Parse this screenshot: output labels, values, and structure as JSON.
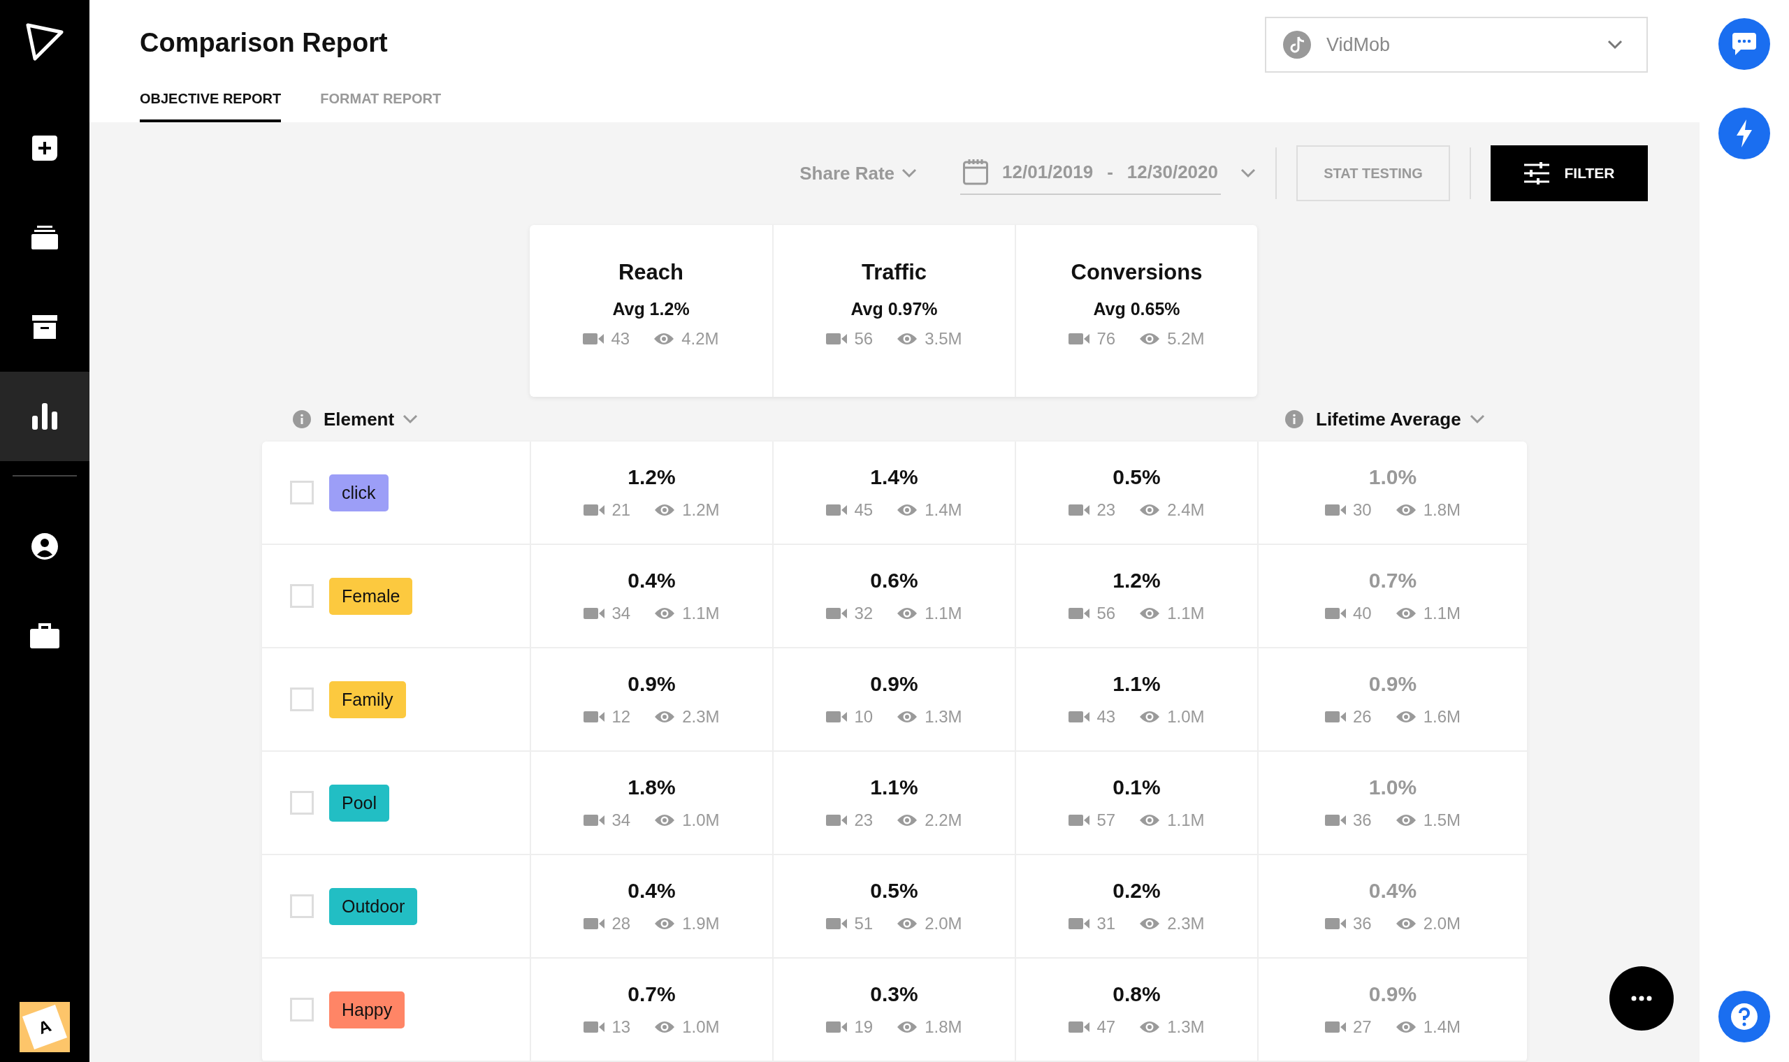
{
  "sidebar": {
    "items": [
      {
        "kind": "add",
        "selected": false
      },
      {
        "kind": "stack",
        "selected": false
      },
      {
        "kind": "archive",
        "selected": false
      },
      {
        "kind": "chart",
        "selected": true
      },
      {
        "kind": "user",
        "selected": false
      },
      {
        "kind": "briefcase",
        "selected": false
      }
    ],
    "avatar": "A"
  },
  "title": "Comparison Report",
  "tabs": [
    {
      "label": "OBJECTIVE REPORT",
      "selected": true
    },
    {
      "label": "FORMAT REPORT",
      "selected": false
    }
  ],
  "account_select": {
    "value": "VidMob"
  },
  "toolbar": {
    "metric": "Share Rate",
    "date_start": "12/01/2019",
    "date_separator": "-",
    "date_end": "12/30/2020",
    "stat_testing": "STAT TESTING",
    "filter": "FILTER"
  },
  "objectives": [
    {
      "name": "Reach",
      "avg": "Avg 1.2%",
      "videos": "43",
      "views": "4.2M"
    },
    {
      "name": "Traffic",
      "avg": "Avg 0.97%",
      "videos": "56",
      "views": "3.5M"
    },
    {
      "name": "Conversions",
      "avg": "Avg 0.65%",
      "videos": "76",
      "views": "5.2M"
    }
  ],
  "element_header": "Element",
  "average_header": "Lifetime Average",
  "rows": [
    {
      "label": "click",
      "color": "#9c9ef7",
      "checked": false,
      "cells": [
        {
          "value": "1.2%",
          "videos": "21",
          "views": "1.2M"
        },
        {
          "value": "1.4%",
          "videos": "45",
          "views": "1.4M"
        },
        {
          "value": "0.5%",
          "videos": "23",
          "views": "2.4M"
        }
      ],
      "average": {
        "value": "1.0%",
        "videos": "30",
        "views": "1.8M"
      }
    },
    {
      "label": "Female",
      "color": "#fcc93f",
      "checked": false,
      "cells": [
        {
          "value": "0.4%",
          "videos": "34",
          "views": "1.1M"
        },
        {
          "value": "0.6%",
          "videos": "32",
          "views": "1.1M"
        },
        {
          "value": "1.2%",
          "videos": "56",
          "views": "1.1M"
        }
      ],
      "average": {
        "value": "0.7%",
        "videos": "40",
        "views": "1.1M"
      }
    },
    {
      "label": "Family",
      "color": "#fcc93f",
      "checked": false,
      "cells": [
        {
          "value": "0.9%",
          "videos": "12",
          "views": "2.3M"
        },
        {
          "value": "0.9%",
          "videos": "10",
          "views": "1.3M"
        },
        {
          "value": "1.1%",
          "videos": "43",
          "views": "1.0M"
        }
      ],
      "average": {
        "value": "0.9%",
        "videos": "26",
        "views": "1.6M"
      }
    },
    {
      "label": "Pool",
      "color": "#22bec4",
      "checked": false,
      "cells": [
        {
          "value": "1.8%",
          "videos": "34",
          "views": "1.0M"
        },
        {
          "value": "1.1%",
          "videos": "23",
          "views": "2.2M"
        },
        {
          "value": "0.1%",
          "videos": "57",
          "views": "1.1M"
        }
      ],
      "average": {
        "value": "1.0%",
        "videos": "36",
        "views": "1.5M"
      }
    },
    {
      "label": "Outdoor",
      "color": "#22bec4",
      "checked": false,
      "cells": [
        {
          "value": "0.4%",
          "videos": "28",
          "views": "1.9M"
        },
        {
          "value": "0.5%",
          "videos": "51",
          "views": "2.0M"
        },
        {
          "value": "0.2%",
          "videos": "31",
          "views": "2.3M"
        }
      ],
      "average": {
        "value": "0.4%",
        "videos": "36",
        "views": "2.0M"
      }
    },
    {
      "label": "Happy",
      "color": "#ff8566",
      "checked": false,
      "cells": [
        {
          "value": "0.7%",
          "videos": "13",
          "views": "1.0M"
        },
        {
          "value": "0.3%",
          "videos": "19",
          "views": "1.8M"
        },
        {
          "value": "0.8%",
          "videos": "47",
          "views": "1.3M"
        }
      ],
      "average": {
        "value": "0.9%",
        "videos": "27",
        "views": "1.4M"
      }
    }
  ]
}
